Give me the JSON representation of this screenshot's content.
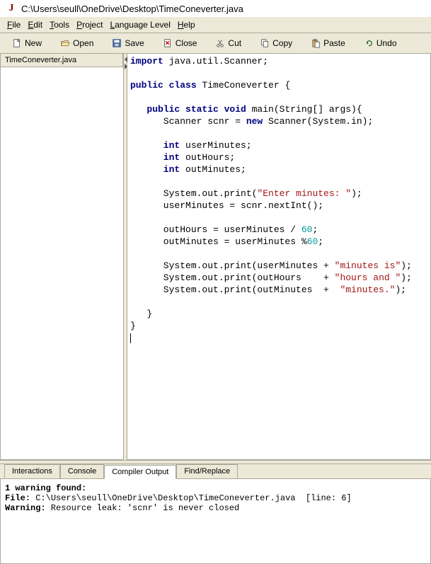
{
  "title": "C:\\Users\\seull\\OneDrive\\Desktop\\TimeConeverter.java",
  "menus": {
    "file": "File",
    "edit": "Edit",
    "tools": "Tools",
    "project": "Project",
    "language": "Language Level",
    "help": "Help"
  },
  "toolbar": {
    "new": "New",
    "open": "Open",
    "save": "Save",
    "close": "Close",
    "cut": "Cut",
    "copy": "Copy",
    "paste": "Paste",
    "undo": "Undo"
  },
  "open_file_tab": "TimeConeverter.java",
  "code": {
    "l1a": "import",
    "l1b": " java.util.Scanner;",
    "l3a": "public class",
    "l3b": " TimeConeverter {",
    "l5a": "   public static void",
    "l5b": " main(String[] args){",
    "l6a": "      Scanner scnr = ",
    "l6b": "new",
    "l6c": " Scanner(System.in);",
    "l8a": "      int",
    "l8b": " userMinutes;",
    "l9a": "      int",
    "l9b": " outHours;",
    "l10a": "      int",
    "l10b": " outMinutes;",
    "l12a": "      System.out.print(",
    "l12b": "\"Enter minutes: \"",
    "l12c": ");",
    "l13": "      userMinutes = scnr.nextInt();",
    "l15a": "      outHours = userMinutes / ",
    "l15b": "60",
    "l15c": ";",
    "l16a": "      outMinutes = userMinutes %",
    "l16b": "60",
    "l16c": ";",
    "l18a": "      System.out.print(userMinutes + ",
    "l18b": "\"minutes is\"",
    "l18c": ");",
    "l19a": "      System.out.print(outHours    + ",
    "l19b": "\"hours and \"",
    "l19c": ");",
    "l20a": "      System.out.print(outMinutes  +  ",
    "l20b": "\"minutes.\"",
    "l20c": ");",
    "l22": "   }",
    "l23": "}"
  },
  "bottom_tabs": {
    "interactions": "Interactions",
    "console": "Console",
    "compiler": "Compiler Output",
    "find": "Find/Replace"
  },
  "output": {
    "l1a": "1 warning found:",
    "l2a": "File:",
    "l2b": " C:\\Users\\seull\\OneDrive\\Desktop\\TimeConeverter.java  [line: 6]",
    "l3a": "Warning:",
    "l3b": " Resource leak: 'scnr' is never closed"
  }
}
